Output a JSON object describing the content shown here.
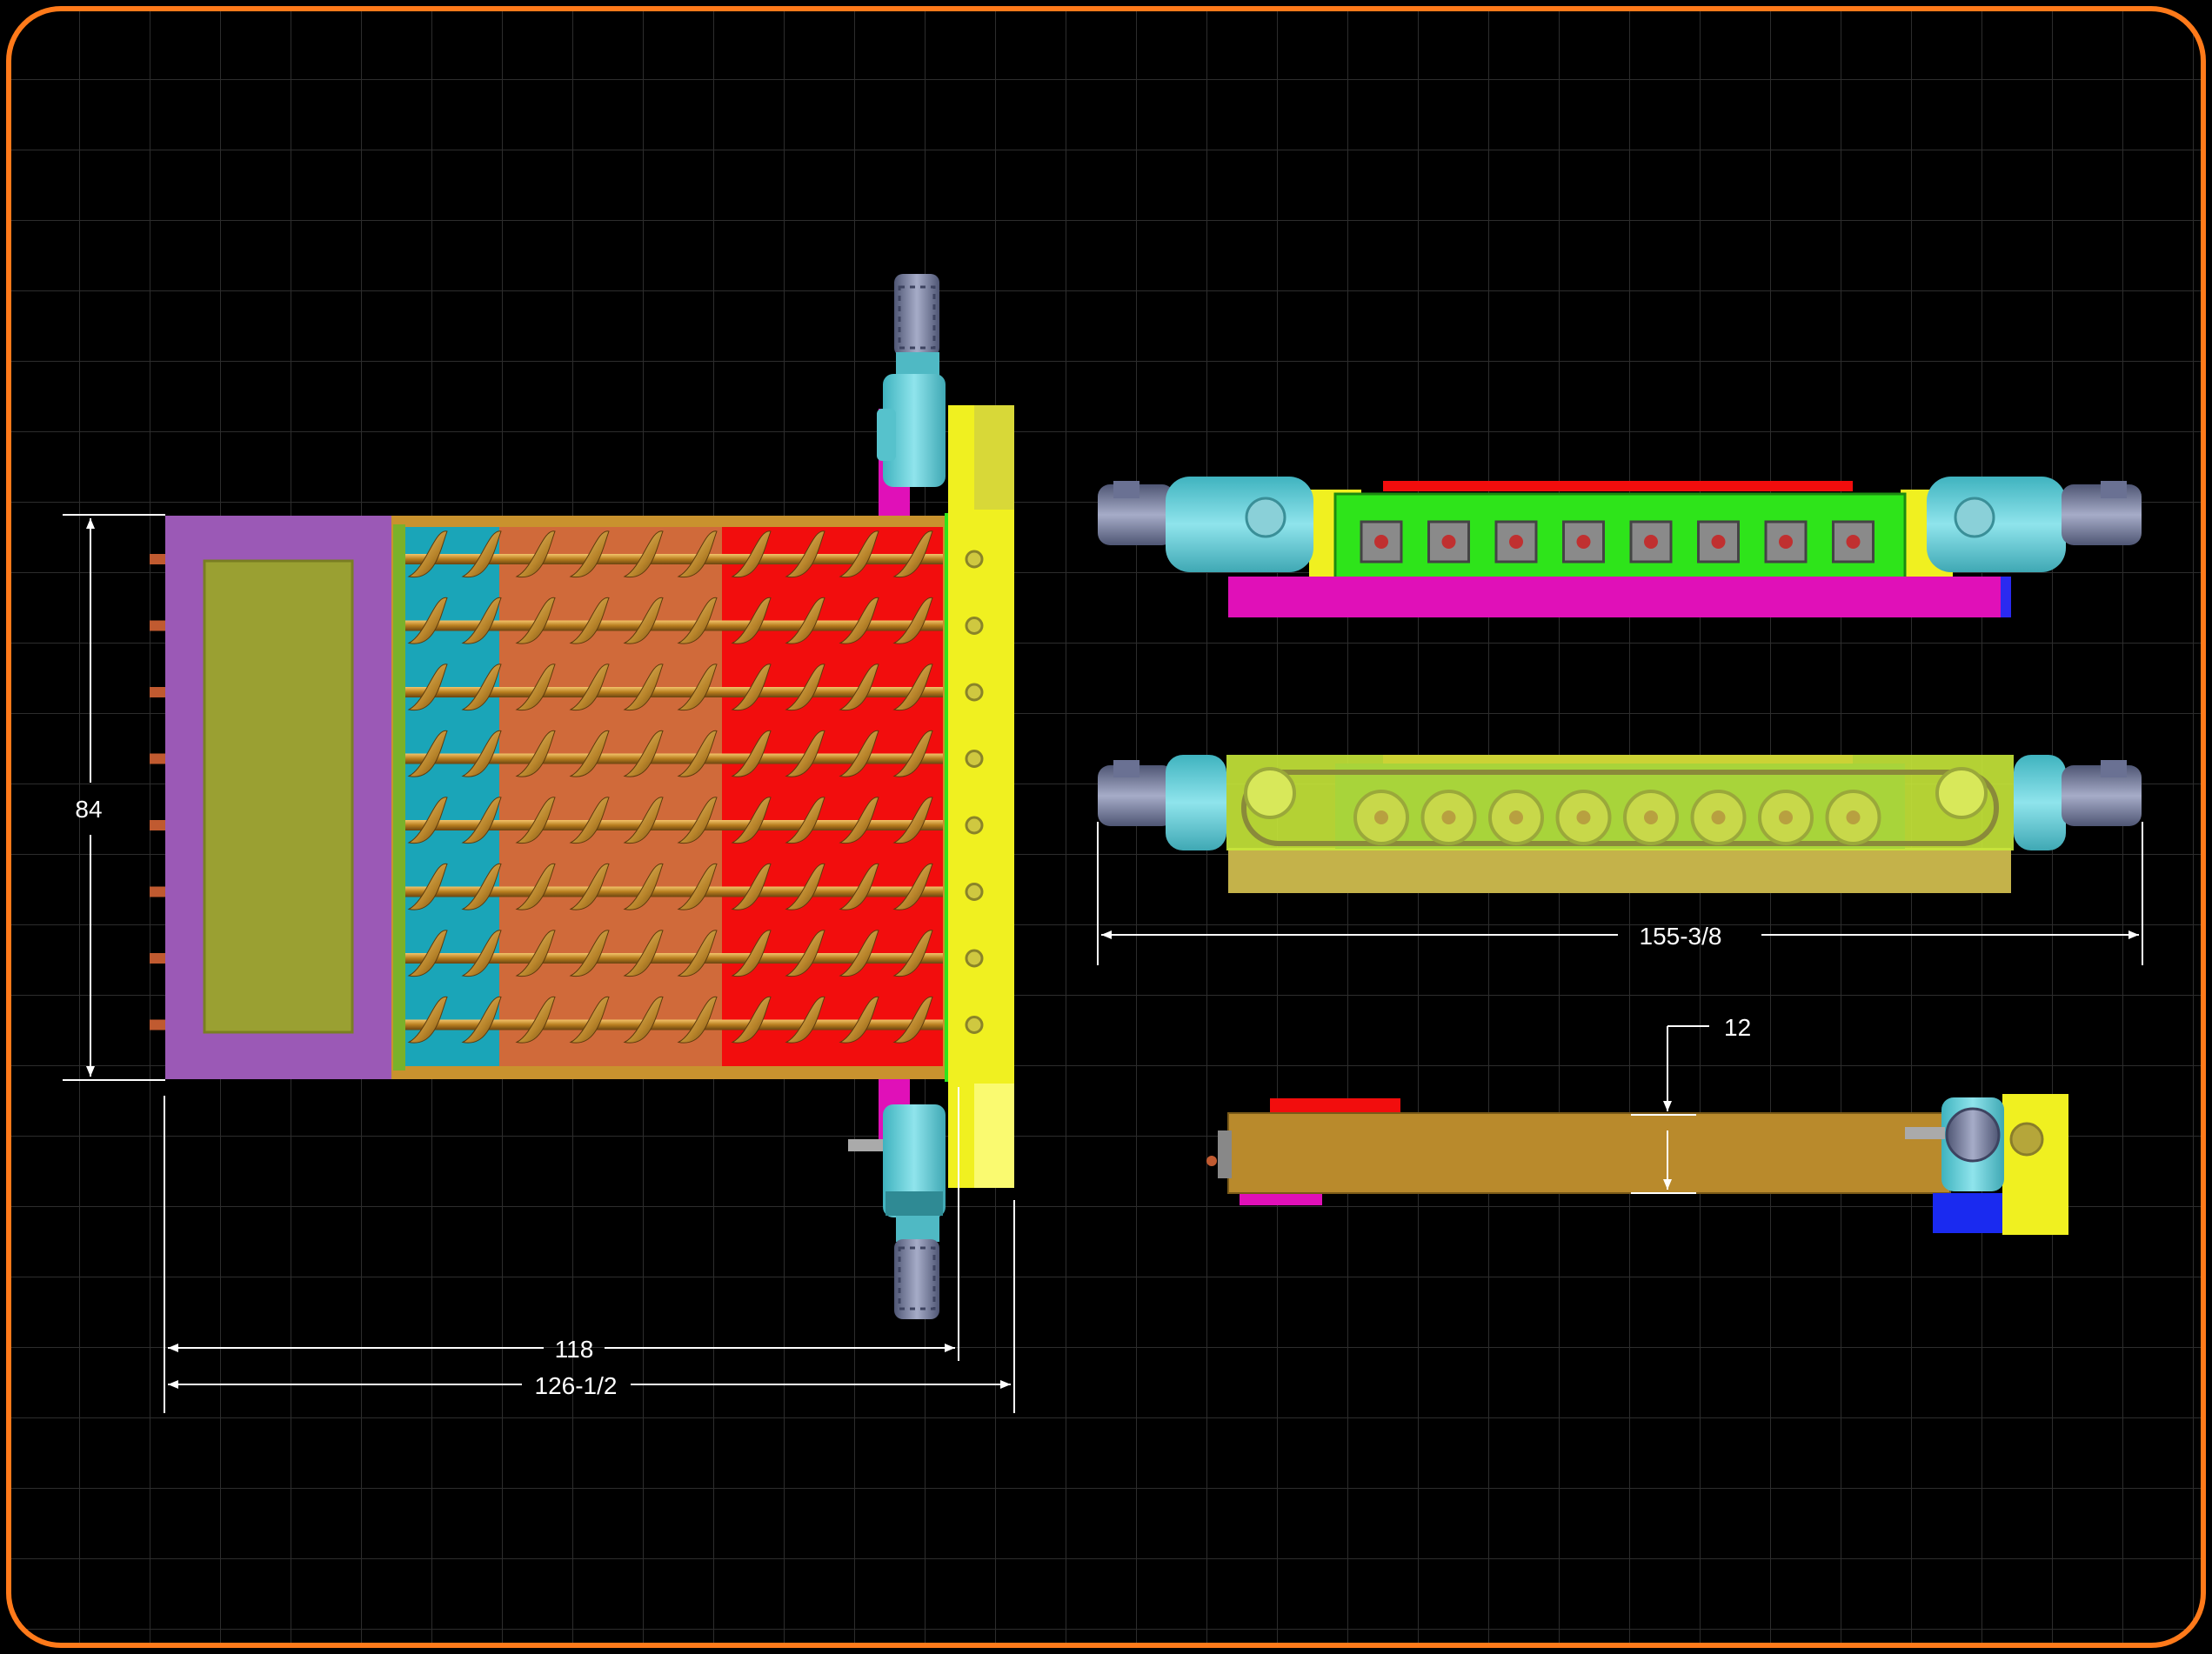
{
  "dimensions": {
    "height_label": "84",
    "width_inner": "118",
    "width_outer": "126-1/2",
    "side_width": "155-3/8",
    "bottom_height": "12"
  },
  "colors": {
    "background": "#000000",
    "frame": "#ff7a1a",
    "grid": "#2f2f2f",
    "purple_housing": "#9b59b6",
    "olive_panel": "#9aa032",
    "teal_zone": "#1aa5b8",
    "orange_zone": "#d06a3a",
    "red_zone": "#f20d0d",
    "screw_gold": "#c9922e",
    "yellow_frame": "#f0f020",
    "motor_cyan": "#68cfd8",
    "motor_grey": "#7f86a8",
    "magenta": "#e010b8",
    "green_box": "#2ee41a",
    "tan_body": "#b98a2c",
    "blue_block": "#1a2af0",
    "dim_line": "#ffffff"
  }
}
